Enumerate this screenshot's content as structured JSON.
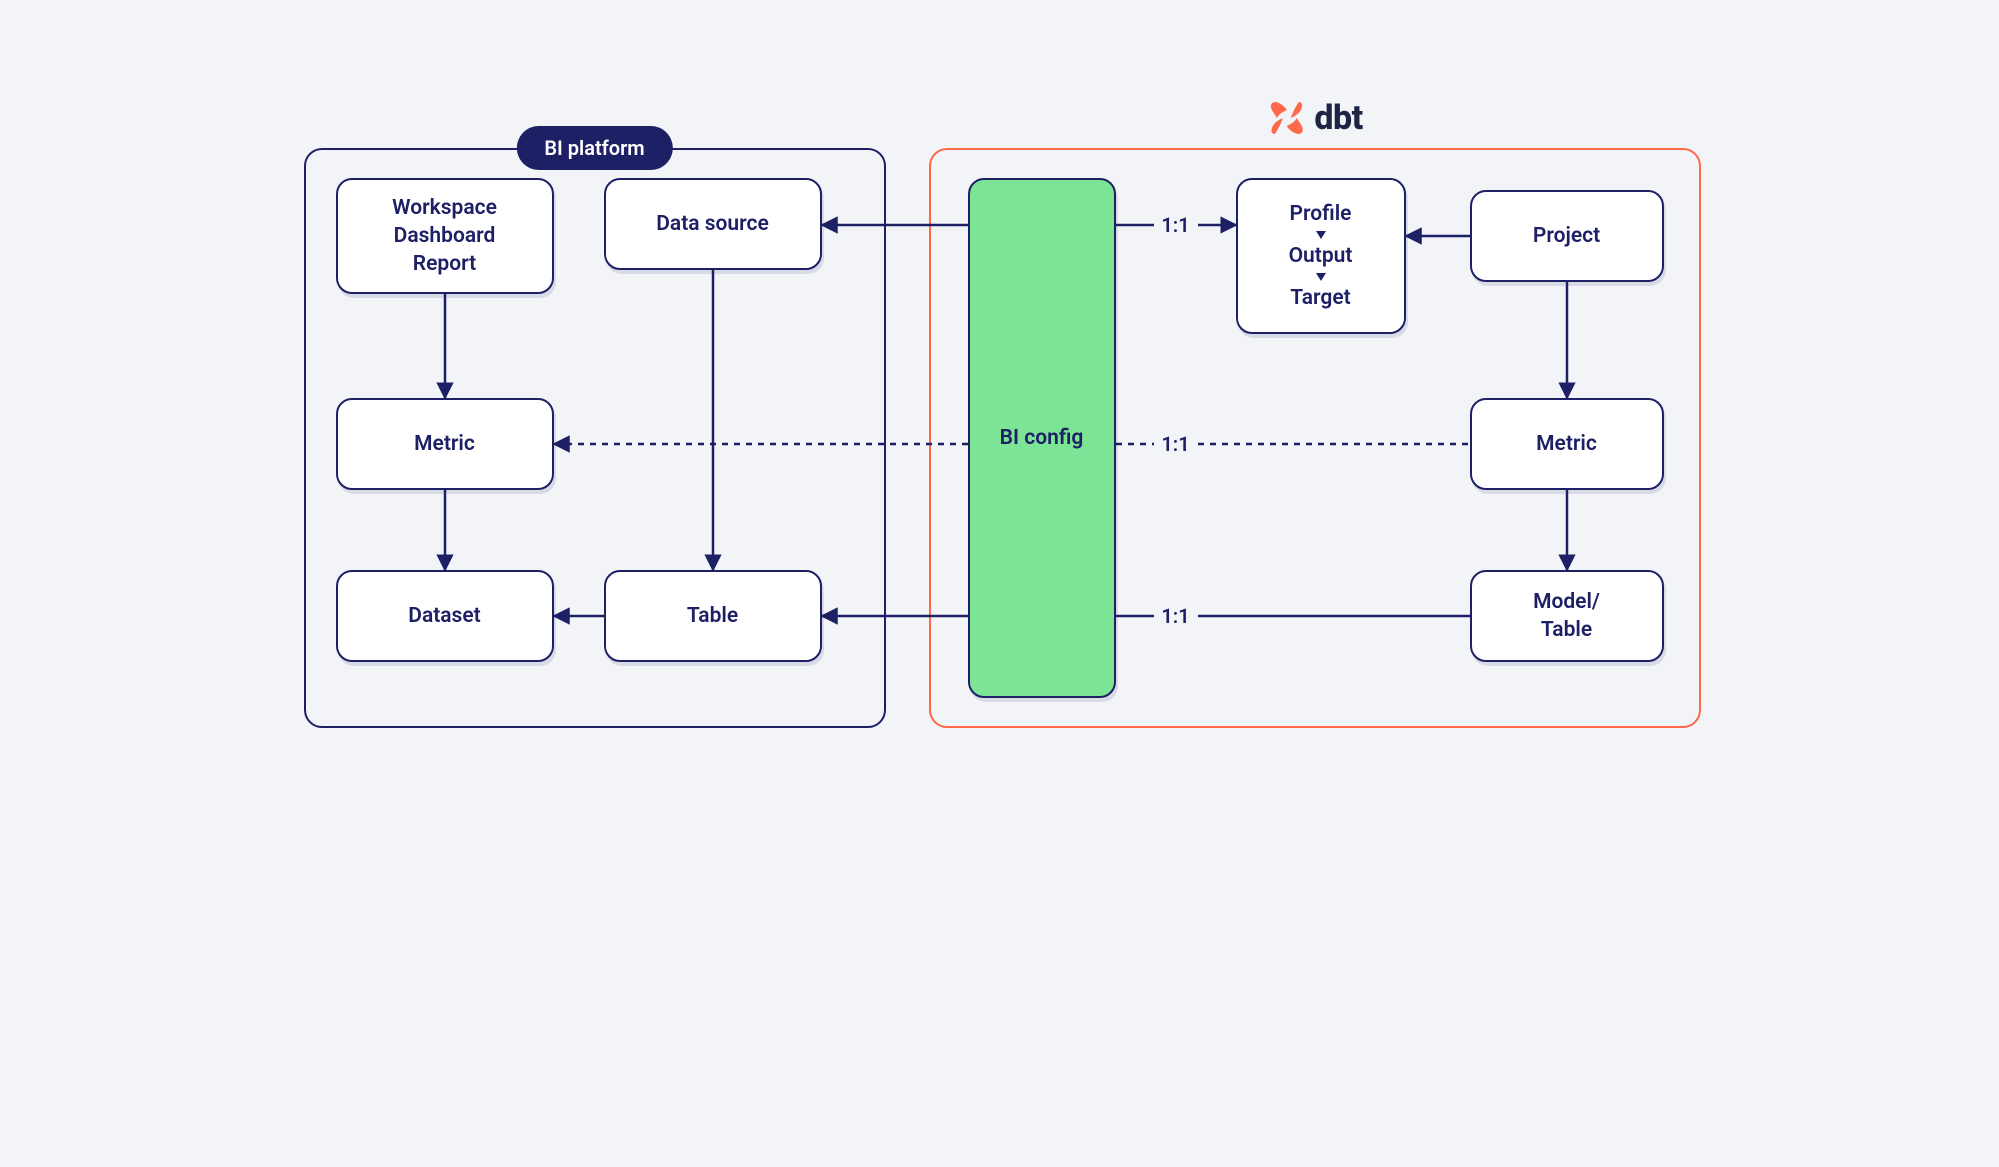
{
  "groups": {
    "bi_platform": {
      "title": "BI platform"
    },
    "dbt": {
      "title": "dbt"
    }
  },
  "nodes": {
    "workspace": {
      "line1": "Workspace",
      "line2": "Dashboard",
      "line3": "Report"
    },
    "data_source": {
      "label": "Data source"
    },
    "metric_bi": {
      "label": "Metric"
    },
    "dataset": {
      "label": "Dataset"
    },
    "table": {
      "label": "Table"
    },
    "bi_config": {
      "label": "BI config"
    },
    "profile": {
      "line1": "Profile",
      "line2": "Output",
      "line3": "Target"
    },
    "project": {
      "label": "Project"
    },
    "metric_dbt": {
      "label": "Metric"
    },
    "model_table": {
      "line1": "Model/",
      "line2": "Table"
    }
  },
  "edges": {
    "ratio_1_1_a": "1:1",
    "ratio_1_1_b": "1:1",
    "ratio_1_1_c": "1:1"
  },
  "colors": {
    "ink": "#1e2066",
    "orange": "#ff694a",
    "green": "#7be495",
    "bg": "#f2f4f8"
  }
}
